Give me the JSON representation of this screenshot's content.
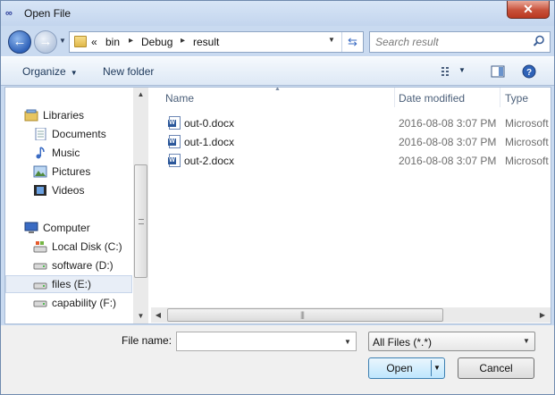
{
  "window": {
    "title": "Open File",
    "close_label": "✕"
  },
  "address": {
    "prefix": "«",
    "crumbs": [
      "bin",
      "Debug",
      "result"
    ],
    "separator": "▸"
  },
  "search": {
    "placeholder": "Search result"
  },
  "toolbar": {
    "organize_label": "Organize",
    "new_folder_label": "New folder"
  },
  "nav": {
    "items": [
      {
        "label": "Libraries",
        "icon": "libraries-icon"
      },
      {
        "label": "Documents",
        "icon": "documents-icon"
      },
      {
        "label": "Music",
        "icon": "music-icon"
      },
      {
        "label": "Pictures",
        "icon": "pictures-icon"
      },
      {
        "label": "Videos",
        "icon": "videos-icon"
      },
      {
        "label": "Computer",
        "icon": "computer-icon"
      },
      {
        "label": "Local Disk (C:)",
        "icon": "system-drive-icon"
      },
      {
        "label": "software (D:)",
        "icon": "drive-icon"
      },
      {
        "label": "files (E:)",
        "icon": "drive-icon",
        "selected": true
      },
      {
        "label": "capability (F:)",
        "icon": "drive-icon"
      }
    ]
  },
  "columns": {
    "name": "Name",
    "date": "Date modified",
    "type": "Type"
  },
  "files": [
    {
      "name": "out-0.docx",
      "date": "2016-08-08 3:07 PM",
      "type": "Microsoft"
    },
    {
      "name": "out-1.docx",
      "date": "2016-08-08 3:07 PM",
      "type": "Microsoft"
    },
    {
      "name": "out-2.docx",
      "date": "2016-08-08 3:07 PM",
      "type": "Microsoft"
    }
  ],
  "footer": {
    "file_name_label": "File name:",
    "file_name_value": "",
    "filter_value": "All Files (*.*)",
    "open_label": "Open",
    "cancel_label": "Cancel"
  }
}
